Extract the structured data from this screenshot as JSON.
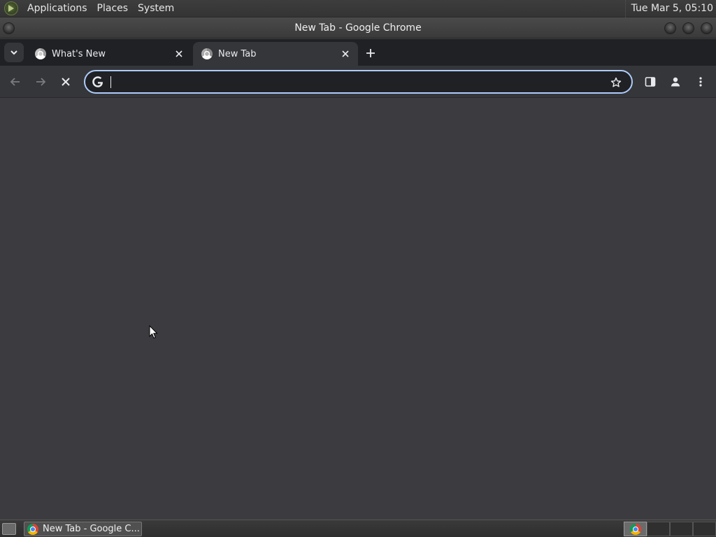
{
  "desktop": {
    "menu": [
      "Applications",
      "Places",
      "System"
    ],
    "clock": "Tue Mar  5, 05:10"
  },
  "window": {
    "title": "New Tab - Google Chrome"
  },
  "tabs": [
    {
      "label": "What's New",
      "icon": "chrome-icon",
      "active": false
    },
    {
      "label": "New Tab",
      "icon": "chrome-icon",
      "active": true
    }
  ],
  "omnibox": {
    "value": "",
    "placeholder": ""
  },
  "taskbar": {
    "task_label": "New Tab - Google C..."
  },
  "colors": {
    "omnibox_focus": "#aecbfa",
    "content_bg": "#3c3b3f",
    "tabstrip_bg": "#202124",
    "toolbar_bg": "#35363a"
  }
}
